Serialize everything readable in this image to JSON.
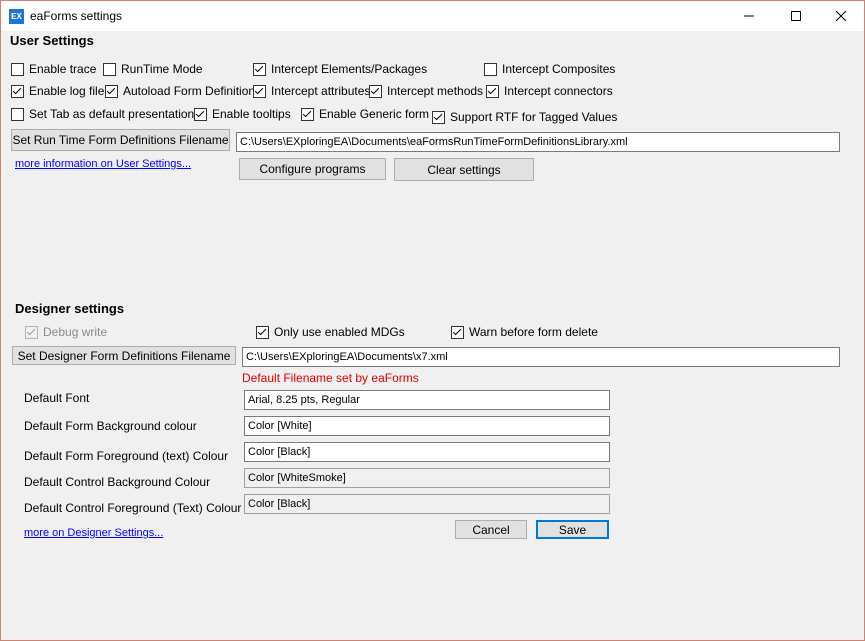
{
  "window": {
    "title": "eaForms settings",
    "icon_text": "EX"
  },
  "user_settings": {
    "heading": "User Settings",
    "checkboxes": [
      {
        "label": "Enable trace",
        "checked": false
      },
      {
        "label": "RunTime Mode",
        "checked": false
      },
      {
        "label": "Intercept Elements/Packages",
        "checked": true
      },
      {
        "label": "Intercept Composites",
        "checked": false
      },
      {
        "label": "Enable log file",
        "checked": true
      },
      {
        "label": "Autoload Form Definitions",
        "checked": true
      },
      {
        "label": "Intercept attributes",
        "checked": true
      },
      {
        "label": "Intercept methods",
        "checked": true
      },
      {
        "label": "Intercept connectors",
        "checked": true
      },
      {
        "label": "Set Tab as default presentation",
        "checked": false
      },
      {
        "label": "Enable tooltips",
        "checked": true
      },
      {
        "label": "Enable Generic form",
        "checked": true
      },
      {
        "label": "Support RTF for Tagged Values",
        "checked": true
      }
    ],
    "set_runtime_button": "Set Run Time Form Definitions Filename",
    "runtime_path": "C:\\Users\\EXploringEA\\Documents\\eaFormsRunTimeFormDefinitionsLibrary.xml",
    "more_info_link": "more information on User Settings...",
    "configure_button": "Configure programs",
    "clear_button": "Clear  settings"
  },
  "designer_settings": {
    "heading": "Designer settings",
    "checkboxes": [
      {
        "label": "Debug write",
        "checked": true,
        "disabled": true
      },
      {
        "label": "Only use enabled MDGs",
        "checked": true
      },
      {
        "label": "Warn before form delete",
        "checked": true
      }
    ],
    "set_designer_button": "Set Designer Form Definitions Filename",
    "designer_path": "C:\\Users\\EXploringEA\\Documents\\x7.xml",
    "default_note": "Default Filename set by eaForms",
    "fields": [
      {
        "label": "Default Font",
        "value": "Arial, 8.25 pts, Regular"
      },
      {
        "label": "Default Form Background colour",
        "value": "Color [White]"
      },
      {
        "label": "Default Form Foreground (text)  Colour",
        "value": "Color [Black]"
      },
      {
        "label": "Default Control Background Colour",
        "value": "Color [WhiteSmoke]"
      },
      {
        "label": "Default Control Foreground (Text) Colour",
        "value": "Color [Black]"
      }
    ],
    "more_link": "more on Designer Settings...",
    "cancel_button": "Cancel",
    "save_button": "Save"
  },
  "colors": {
    "accent": "#0078d7",
    "link": "#0000ff",
    "note": "#e00000",
    "background": "#f0f0f0"
  }
}
